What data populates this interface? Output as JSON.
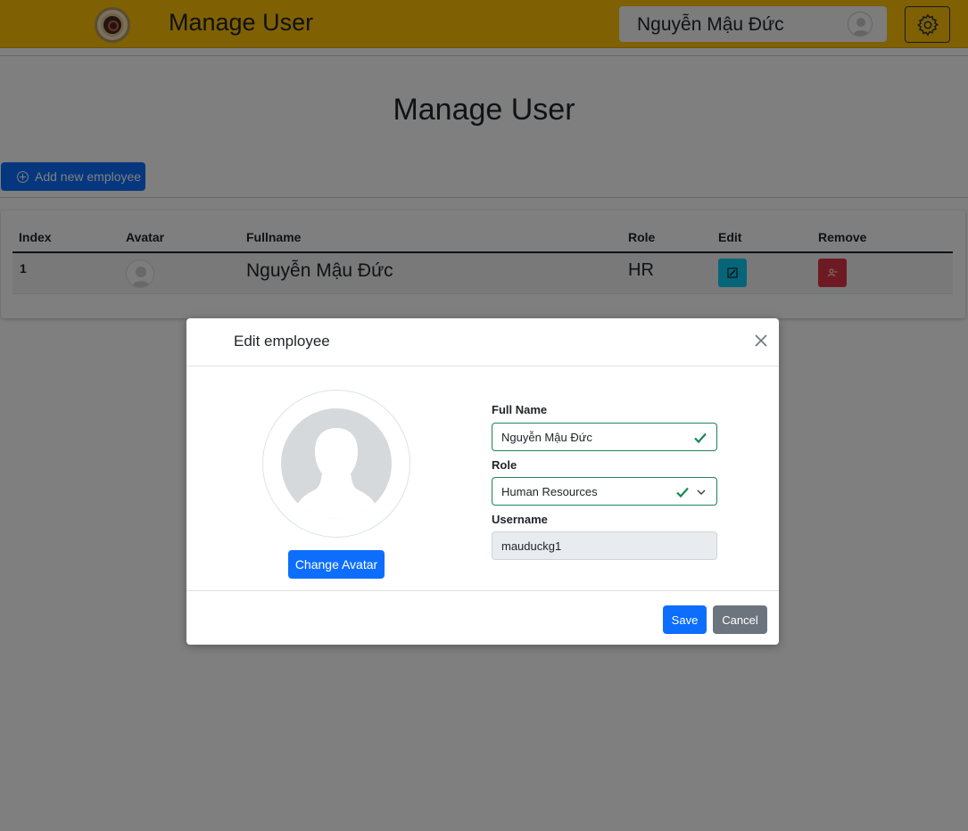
{
  "header": {
    "app_title": "Manage User",
    "user_name": "Nguyễn Mậu Đức",
    "brand_color": "#ffc107"
  },
  "main": {
    "page_title": "Manage User",
    "add_button_label": "Add new employee"
  },
  "table": {
    "columns": [
      "Index",
      "Avatar",
      "Fullname",
      "Role",
      "Edit",
      "Remove"
    ],
    "rows": [
      {
        "index": "1",
        "fullname": "Nguyễn Mậu Đức",
        "role": "HR"
      }
    ]
  },
  "modal": {
    "title": "Edit employee",
    "change_avatar_label": "Change Avatar",
    "fullname_label": "Full Name",
    "fullname_value": "Nguyễn Mậu Đức",
    "role_label": "Role",
    "role_value": "Human Resources",
    "username_label": "Username",
    "username_value": "mauduckg1",
    "save_label": "Save",
    "cancel_label": "Cancel"
  },
  "colors": {
    "primary": "#0d6efd",
    "info": "#0dcaf0",
    "danger": "#dc3545",
    "success": "#198754",
    "secondary": "#6c757d"
  }
}
